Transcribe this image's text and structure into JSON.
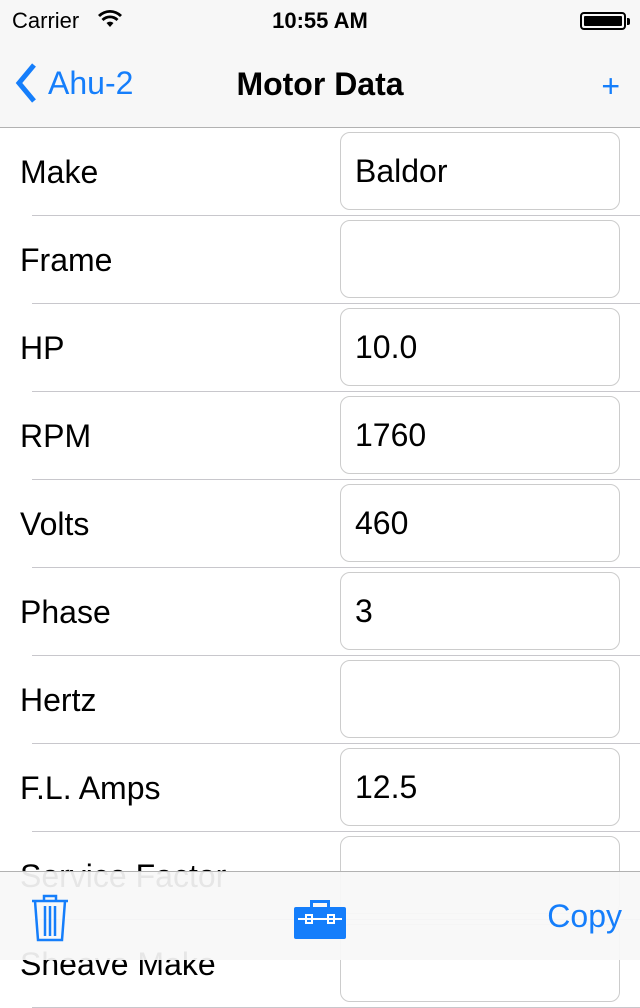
{
  "status_bar": {
    "carrier": "Carrier",
    "time": "10:55 AM",
    "battery_level": 1.0
  },
  "nav": {
    "back_label": "Ahu-2",
    "title": "Motor Data",
    "add_label": "+"
  },
  "rows": [
    {
      "label": "Make",
      "value": "Baldor"
    },
    {
      "label": "Frame",
      "value": ""
    },
    {
      "label": "HP",
      "value": "10.0"
    },
    {
      "label": "RPM",
      "value": "1760"
    },
    {
      "label": "Volts",
      "value": "460"
    },
    {
      "label": "Phase",
      "value": "3"
    },
    {
      "label": "Hertz",
      "value": ""
    },
    {
      "label": "F.L. Amps",
      "value": "12.5"
    },
    {
      "label": "Service Factor",
      "value": ""
    },
    {
      "label": "Sheave Make",
      "value": ""
    }
  ],
  "toolbar": {
    "delete_icon": "trash-icon",
    "tools_icon": "toolbox-icon",
    "copy_label": "Copy"
  },
  "colors": {
    "accent": "#157efb"
  }
}
